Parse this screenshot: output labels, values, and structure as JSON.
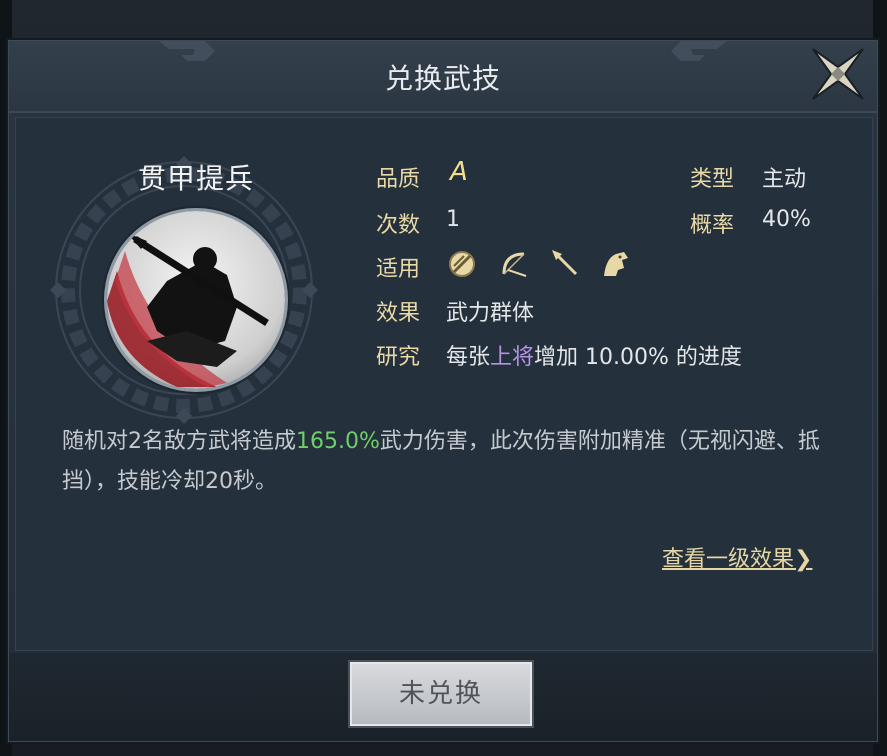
{
  "dialog": {
    "title": "兑换武技"
  },
  "skill": {
    "name": "贯甲提兵",
    "quality_label": "品质",
    "quality_value": "A",
    "type_label": "类型",
    "type_value": "主动",
    "count_label": "次数",
    "count_value": "1",
    "chance_label": "概率",
    "chance_value": "40%",
    "applicable_label": "适用",
    "applicable_icons": [
      "shield-unit-icon",
      "bow-unit-icon",
      "spear-unit-icon",
      "cavalry-unit-icon"
    ],
    "effect_label": "效果",
    "effect_value": "武力群体",
    "research_label": "研究",
    "research_prefix": "每张",
    "research_highlight": "上将",
    "research_suffix": "增加 10.00% 的进度"
  },
  "description": {
    "part1": "随机对2名敌方武将造成",
    "highlight": "165.0%",
    "part2": "武力伤害，此次伤害附加精准（无视闪避、抵挡），技能冷却20秒。"
  },
  "link": {
    "label": "查看一级效果",
    "arrow": "❯"
  },
  "button": {
    "label": "未兑换"
  },
  "colors": {
    "label": "#e9d9a7",
    "grade": "#f3e08c",
    "highlight_purple": "#b592e2",
    "highlight_green": "#6fcf6a"
  }
}
